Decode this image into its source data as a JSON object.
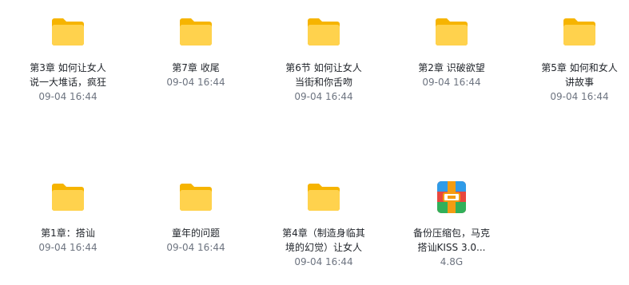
{
  "items": [
    {
      "type": "folder",
      "name_line1": "第3章 如何让女人",
      "name_line2": "说一大堆话，疯狂",
      "meta": "09-04 16:44"
    },
    {
      "type": "folder",
      "name_line1": "第7章 收尾",
      "name_line2": "",
      "meta": "09-04 16:44"
    },
    {
      "type": "folder",
      "name_line1": "第6节 如何让女人",
      "name_line2": "当街和你舌吻",
      "meta": "09-04 16:44"
    },
    {
      "type": "folder",
      "name_line1": "第2章 识破欲望",
      "name_line2": "",
      "meta": "09-04 16:44"
    },
    {
      "type": "folder",
      "name_line1": "第5章 如何和女人",
      "name_line2": "讲故事",
      "meta": "09-04 16:44"
    },
    {
      "type": "folder",
      "name_line1": "第1章：搭讪",
      "name_line2": "",
      "meta": "09-04 16:44"
    },
    {
      "type": "folder",
      "name_line1": "童年的问题",
      "name_line2": "",
      "meta": "09-04 16:44"
    },
    {
      "type": "folder",
      "name_line1": "第4章（制造身临其",
      "name_line2": "境的幻觉）让女人",
      "meta": "09-04 16:44"
    },
    {
      "type": "archive",
      "name_line1": "备份压缩包，马克",
      "name_line2": "搭讪KISS 3.0...",
      "meta": "4.8G"
    }
  ],
  "colors": {
    "folder_back": "#f6b400",
    "folder_front": "#ffd24d",
    "archive_blue": "#2f9be8",
    "archive_red": "#e8473e",
    "archive_green": "#31b05a",
    "archive_orange": "#f39c12"
  }
}
